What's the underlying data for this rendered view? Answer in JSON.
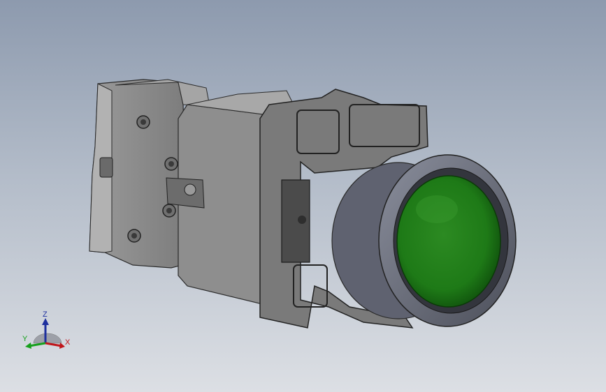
{
  "viewport": {
    "background_top": "#8d9aae",
    "background_bottom": "#dcdfe4"
  },
  "model": {
    "part": "push-button",
    "body_color": "#8c8c8c",
    "button_color": "#1e7a17",
    "bezel_color": "#6e7282"
  },
  "triad": {
    "z_label": "Z",
    "y_label": "Y",
    "x_label": "X",
    "z_color": "#1d2f9e",
    "y_color": "#16a01c",
    "x_color": "#c0161b"
  }
}
